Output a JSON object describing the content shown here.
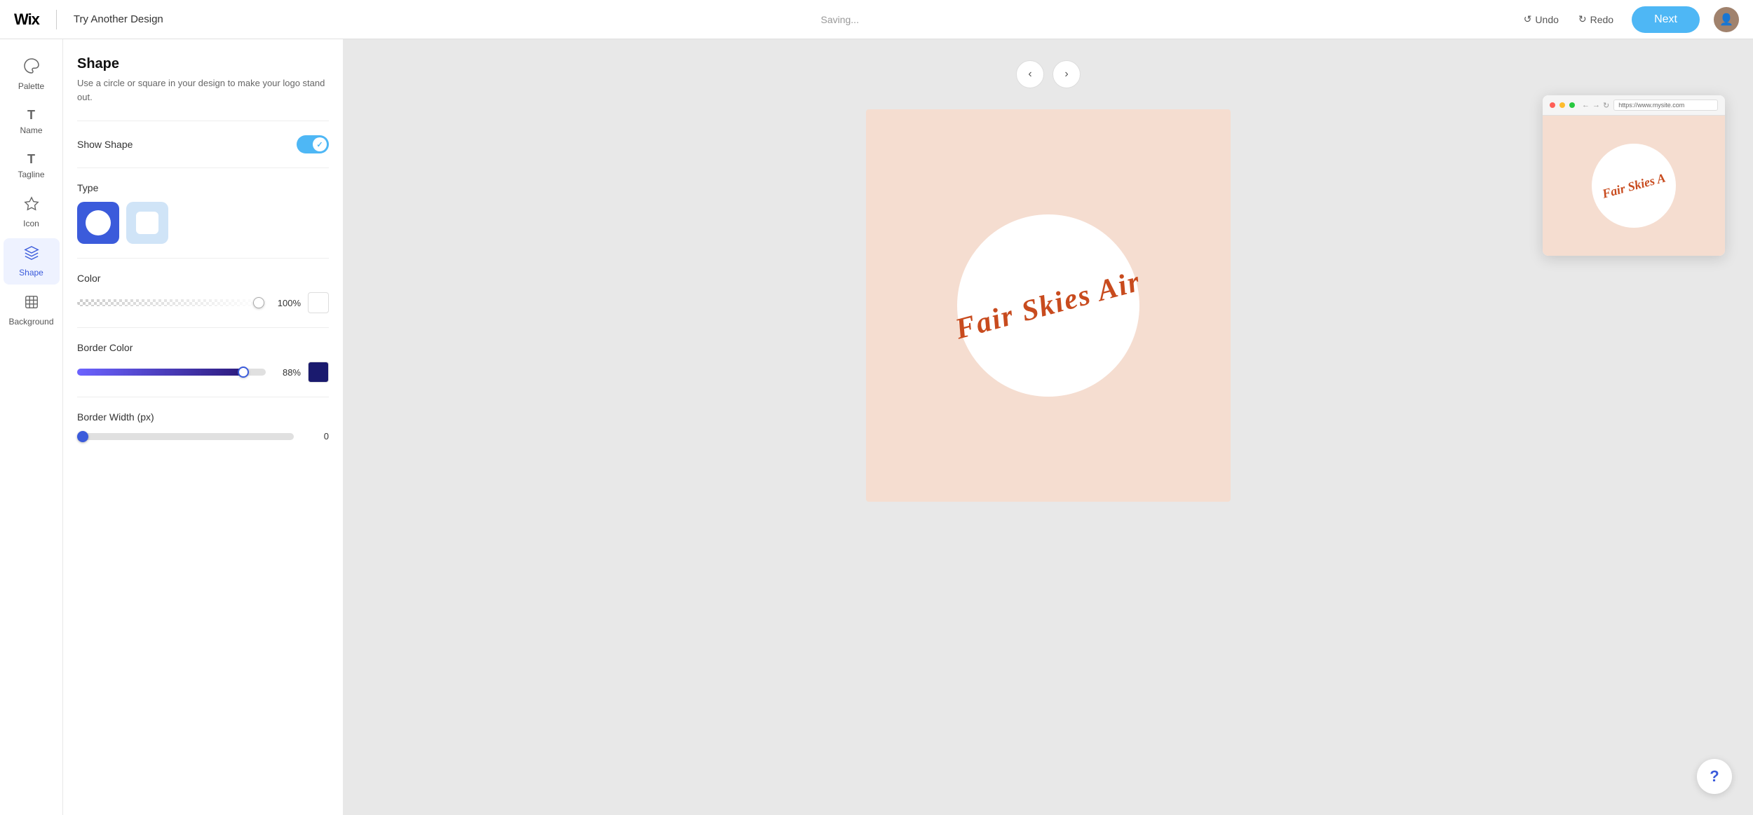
{
  "header": {
    "logo_text": "Wix",
    "title": "Try Another Design",
    "saving_text": "Saving...",
    "undo_label": "Undo",
    "redo_label": "Redo",
    "next_label": "Next"
  },
  "nav": {
    "items": [
      {
        "id": "palette",
        "label": "Palette",
        "icon": "◇"
      },
      {
        "id": "name",
        "label": "Name",
        "icon": "T"
      },
      {
        "id": "tagline",
        "label": "Tagline",
        "icon": "T"
      },
      {
        "id": "icon",
        "label": "Icon",
        "icon": "★"
      },
      {
        "id": "shape",
        "label": "Shape",
        "icon": "◇",
        "active": true
      },
      {
        "id": "background",
        "label": "Background",
        "icon": "▤"
      }
    ]
  },
  "panel": {
    "title": "Shape",
    "description": "Use a circle or square in your design to make your logo stand out.",
    "show_shape_label": "Show Shape",
    "show_shape_enabled": true,
    "type_label": "Type",
    "color_label": "Color",
    "color_opacity": "100%",
    "color_swatch": "#fff",
    "border_color_label": "Border Color",
    "border_color_opacity": "88%",
    "border_color_swatch": "#1a1a6e",
    "border_width_label": "Border Width (px)",
    "border_width_value": "0"
  },
  "canvas": {
    "logo_text": "Fair Skies Air",
    "background_color": "#f5ddd0",
    "circle_color": "#ffffff",
    "text_color": "#C84B1E",
    "nav_prev_label": "‹",
    "nav_next_label": "›"
  },
  "browser_preview": {
    "url": "https://www.mysite.com",
    "logo_text": "Fair Skies A"
  },
  "help": {
    "label": "?"
  }
}
